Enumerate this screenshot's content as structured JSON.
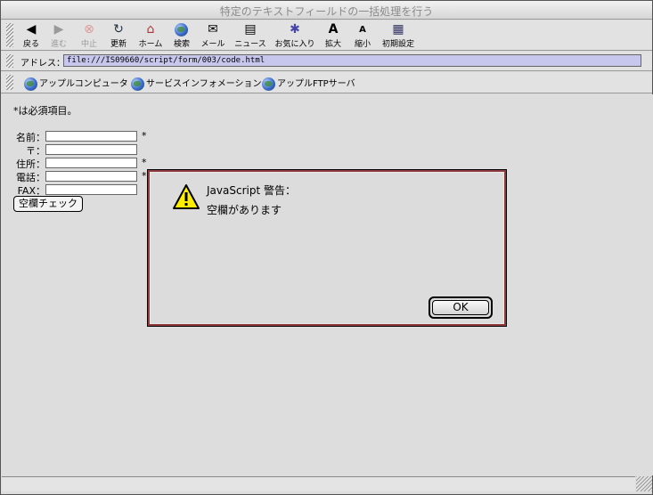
{
  "window": {
    "title": "特定のテキストフィールドの一括処理を行う"
  },
  "toolbar": {
    "buttons": [
      {
        "label": "戻る",
        "icon": "back-arrow-icon",
        "enabled": true
      },
      {
        "label": "進む",
        "icon": "forward-arrow-icon",
        "enabled": false
      },
      {
        "label": "中止",
        "icon": "stop-icon",
        "enabled": false
      },
      {
        "label": "更新",
        "icon": "refresh-icon",
        "enabled": true
      },
      {
        "label": "ホーム",
        "icon": "home-icon",
        "enabled": true
      },
      {
        "label": "検索",
        "icon": "search-icon",
        "enabled": true
      },
      {
        "label": "メール",
        "icon": "mail-icon",
        "enabled": true
      },
      {
        "label": "ニュース",
        "icon": "news-icon",
        "enabled": true
      },
      {
        "label": "お気に入り",
        "icon": "favorites-icon",
        "enabled": true
      },
      {
        "label": "拡大",
        "icon": "font-larger-icon",
        "enabled": true
      },
      {
        "label": "縮小",
        "icon": "font-smaller-icon",
        "enabled": true
      },
      {
        "label": "初期設定",
        "icon": "preferences-icon",
        "enabled": true
      }
    ]
  },
  "address_bar": {
    "label": "アドレス：",
    "url": "file:///IS09660/script/form/003/code.html"
  },
  "links_bar": {
    "links": [
      {
        "label": "アップルコンピュータ"
      },
      {
        "label": "サービスインフォメーション"
      },
      {
        "label": "アップルFTPサーバ"
      }
    ]
  },
  "form": {
    "note": "*は必須項目。",
    "fields": [
      {
        "label": "名前：",
        "value": "",
        "required_mark": "*"
      },
      {
        "label": "〒：",
        "value": "",
        "required_mark": ""
      },
      {
        "label": "住所：",
        "value": "",
        "required_mark": "*"
      },
      {
        "label": "電話：",
        "value": "",
        "required_mark": "*"
      },
      {
        "label": "FAX：",
        "value": "",
        "required_mark": ""
      }
    ],
    "check_button": "空欄チェック"
  },
  "alert": {
    "title": "JavaScript 警告：",
    "message": "空欄があります",
    "ok_label": "OK",
    "icon": "warning-icon"
  },
  "colors": {
    "dialog_border": "#8f3b3b",
    "address_field": "#c7c7ee"
  }
}
